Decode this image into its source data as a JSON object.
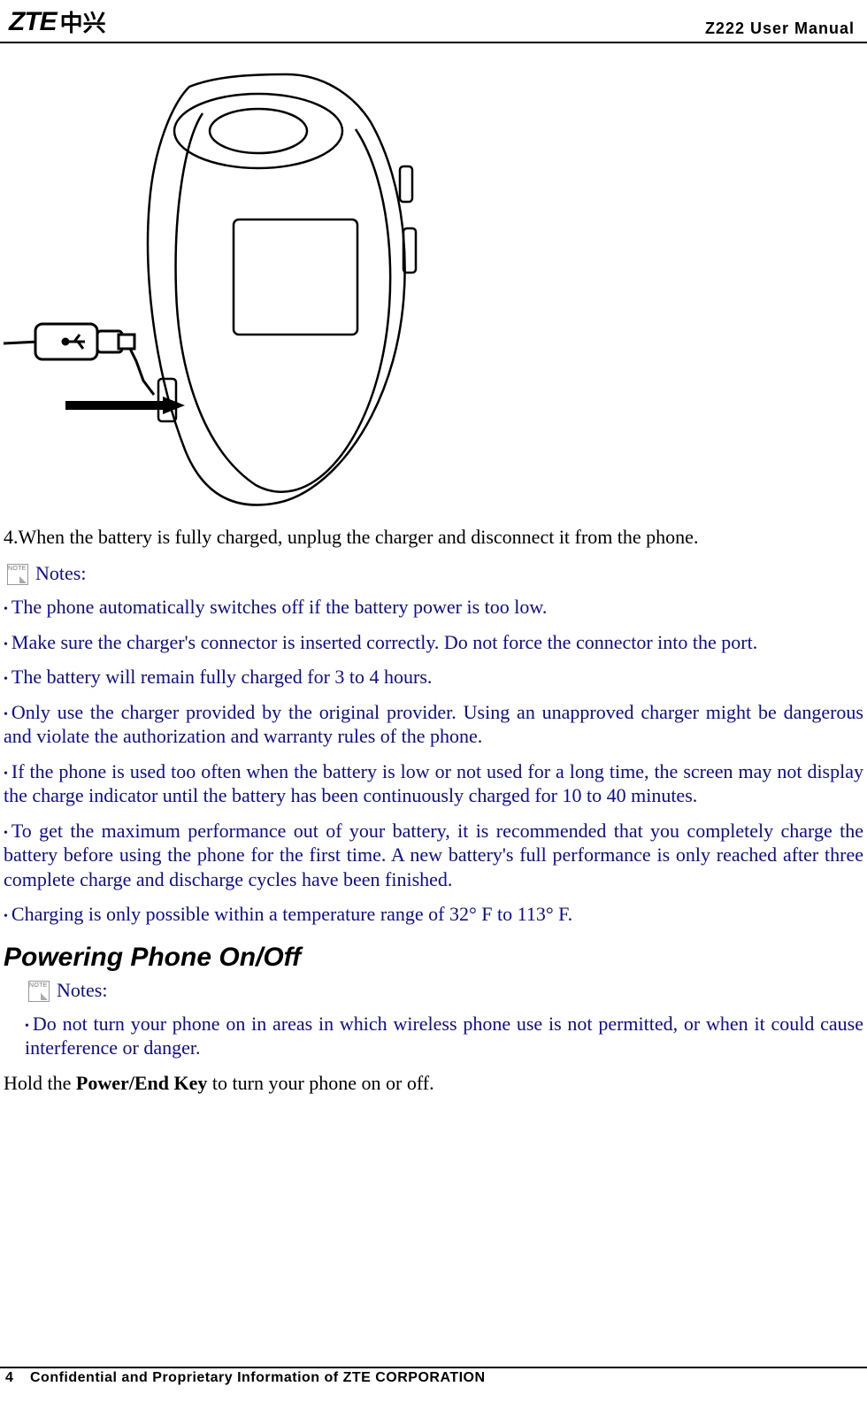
{
  "header": {
    "logo_latin": "ZTE",
    "logo_cn": "中兴",
    "doc_title": "Z222 User Manual"
  },
  "step4": "4.When the battery is fully charged, unplug the charger and disconnect it from the phone.",
  "notes_label": "Notes:",
  "notes1": [
    "The phone automatically switches off if the battery power is too low.",
    "Make  sure  the  charger's  connector  is  inserted correctly. Do not force the connector into the port.",
    "The  battery  will  remain  fully  charged  for  3 to 4 hours.",
    "Only  use  the  charger  provided  by  the  original  provider.  Using  an  unapproved  charger  might  be dangerous and violate the authorization and warranty rules of the phone.",
    "If  the  phone  is  used  too  often  when  the battery is low or not used for a long time, the screen may not display the charge indicator until the battery has been continuously charged for 10 to 40 minutes.",
    "To  get  the  maximum  performance  out  of  your battery, it is recommended that you completely charge the battery before using the phone for the first time. A new battery's full performance is only reached after three complete charge and discharge cycles have been finished.",
    "Charging  is  only  possible  within  a  temperature range of 32° F to 113° F."
  ],
  "section_power": "Powering Phone On/Off",
  "notes2": [
    "Do  not  turn  your  phone  on  in  areas  in which wireless phone use is not permitted, or when it could cause interference or danger."
  ],
  "hold_pre": "Hold the ",
  "hold_bold": "Power/End Key",
  "hold_post": " to turn your phone on or off.",
  "footer": {
    "page_num": "4",
    "text": "Confidential and Proprietary Information of ZTE CORPORATION"
  }
}
